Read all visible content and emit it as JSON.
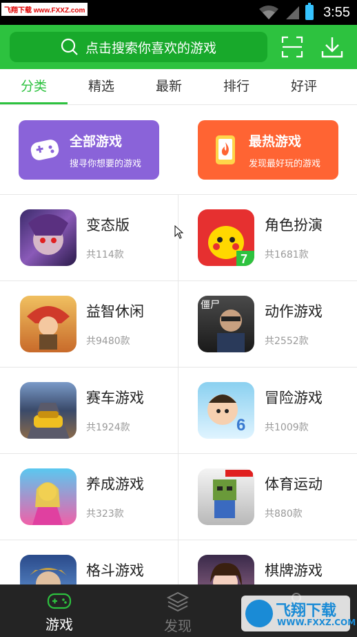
{
  "status_bar": {
    "watermark": "飞翔下载 www.FXXZ.com",
    "time": "3:55"
  },
  "search": {
    "placeholder": "点击搜索你喜欢的游戏"
  },
  "tabs": [
    {
      "label": "分类",
      "active": true
    },
    {
      "label": "精选",
      "active": false
    },
    {
      "label": "最新",
      "active": false
    },
    {
      "label": "排行",
      "active": false
    },
    {
      "label": "好评",
      "active": false
    }
  ],
  "banners": [
    {
      "title": "全部游戏",
      "subtitle": "搜寻你想要的游戏",
      "color": "#8a63d9",
      "icon": "gamepad-icon"
    },
    {
      "title": "最热游戏",
      "subtitle": "发现最好玩的游戏",
      "color": "#ff6433",
      "icon": "flame-phone-icon"
    }
  ],
  "categories": [
    {
      "name": "变态版",
      "count": "共114款"
    },
    {
      "name": "角色扮演",
      "count": "共1681款"
    },
    {
      "name": "益智休闲",
      "count": "共9480款"
    },
    {
      "name": "动作游戏",
      "count": "共2552款"
    },
    {
      "name": "赛车游戏",
      "count": "共1924款"
    },
    {
      "name": "冒险游戏",
      "count": "共1009款"
    },
    {
      "name": "养成游戏",
      "count": "共323款"
    },
    {
      "name": "体育运动",
      "count": "共880款"
    },
    {
      "name": "格斗游戏",
      "count": ""
    },
    {
      "name": "棋牌游戏",
      "count": ""
    }
  ],
  "bottom_nav": [
    {
      "label": "游戏",
      "icon": "gamepad-icon",
      "active": true
    },
    {
      "label": "发现",
      "icon": "cube-icon",
      "active": false
    },
    {
      "label": "",
      "icon": "user-icon",
      "active": false
    }
  ],
  "watermark": {
    "text": "飞翔下载",
    "url": "WWW.FXXZ.COM"
  },
  "colors": {
    "accent": "#2dc23f",
    "header_bg": "#2dc23f",
    "purple": "#8a63d9",
    "orange": "#ff6433",
    "nav_bg": "#242424"
  }
}
